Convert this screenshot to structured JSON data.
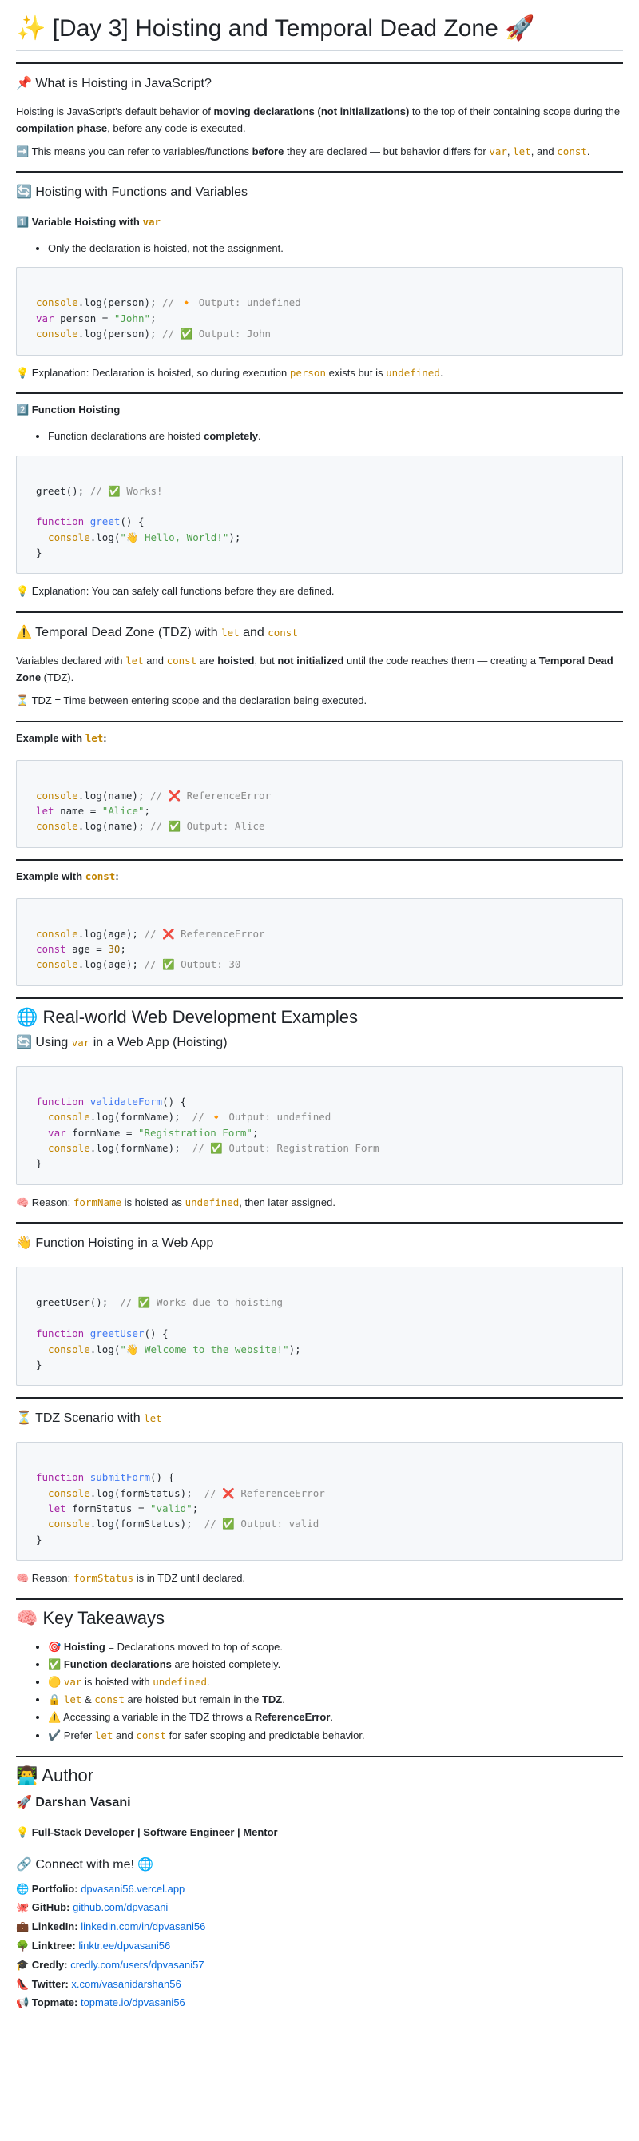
{
  "title": "✨ [Day 3] Hoisting and Temporal Dead Zone 🚀",
  "s1": {
    "heading": "📌 What is Hoisting in JavaScript?",
    "p1_a": "Hoisting is JavaScript's default behavior of ",
    "p1_b": "moving declarations (not initializations)",
    "p1_c": " to the top of their containing scope during the ",
    "p1_d": "compilation phase",
    "p1_e": ", before any code is executed.",
    "p2_a": "➡️ This means you can refer to variables/functions ",
    "p2_b": "before",
    "p2_c": " they are declared — but behavior differs for ",
    "var": "var",
    "let": "let",
    "const": "const",
    "and": ", and ",
    "comma": ", ",
    "dot": "."
  },
  "s2": {
    "heading": "🔄 Hoisting with Functions and Variables",
    "sub1_a": "1️⃣ Variable Hoisting with ",
    "sub1_code": "var",
    "sub1_bullet": "Only the declaration is hoisted, not the assignment.",
    "code1": {
      "l1a": "console",
      "l1b": ".log(person); ",
      "l1c": "// 🔸 Output: undefined",
      "l2a": "var",
      "l2b": " person = ",
      "l2c": "\"John\"",
      "l2d": ";",
      "l3a": "console",
      "l3b": ".log(person); ",
      "l3c": "// ✅ Output: John"
    },
    "expl1_a": "💡 Explanation: Declaration is hoisted, so during execution ",
    "expl1_b": "person",
    "expl1_c": " exists but is ",
    "expl1_d": "undefined",
    "expl1_e": ".",
    "sub2": "2️⃣ Function Hoisting",
    "sub2_bullet_a": "Function declarations are hoisted ",
    "sub2_bullet_b": "completely",
    "sub2_bullet_c": ".",
    "code2": {
      "l1a": "greet(); ",
      "l1b": "// ✅ Works!",
      "l3a": "function",
      "l3b": " greet",
      "l3c": "() {",
      "l4a": "  console",
      "l4b": ".log(",
      "l4c": "\"👋 Hello, World!\"",
      "l4d": ");",
      "l5": "}"
    },
    "expl2": "💡 Explanation: You can safely call functions before they are defined."
  },
  "s3": {
    "heading_a": "⚠️ Temporal Dead Zone (TDZ) with ",
    "heading_b": "let",
    "heading_c": " and ",
    "heading_d": "const",
    "p1_a": "Variables declared with ",
    "p1_b": "let",
    "p1_c": " and ",
    "p1_d": "const",
    "p1_e": " are ",
    "p1_f": "hoisted",
    "p1_g": ", but ",
    "p1_h": "not initialized",
    "p1_i": " until the code reaches them — creating a ",
    "p1_j": "Temporal Dead Zone",
    "p1_k": " (TDZ).",
    "p2": "⏳ TDZ = Time between entering scope and the declaration being executed.",
    "ex1_a": "Example with ",
    "ex1_b": "let",
    "ex1_c": ":",
    "code1": {
      "l1a": "console",
      "l1b": ".log(name); ",
      "l1c": "// ❌ ReferenceError",
      "l2a": "let",
      "l2b": " name = ",
      "l2c": "\"Alice\"",
      "l2d": ";",
      "l3a": "console",
      "l3b": ".log(name); ",
      "l3c": "// ✅ Output: Alice"
    },
    "ex2_a": "Example with ",
    "ex2_b": "const",
    "ex2_c": ":",
    "code2": {
      "l1a": "console",
      "l1b": ".log(age); ",
      "l1c": "// ❌ ReferenceError",
      "l2a": "const",
      "l2b": " age = ",
      "l2c": "30",
      "l2d": ";",
      "l3a": "console",
      "l3b": ".log(age); ",
      "l3c": "// ✅ Output: 30"
    }
  },
  "s4": {
    "heading": "🌐 Real-world Web Development Examples",
    "sub1_a": "🔄 Using ",
    "sub1_b": "var",
    "sub1_c": " in a Web App (Hoisting)",
    "code1": {
      "l1a": "function",
      "l1b": " validateForm",
      "l1c": "() {",
      "l2a": "  console",
      "l2b": ".log(formName);  ",
      "l2c": "// 🔸 Output: undefined",
      "l3a": "  var",
      "l3b": " formName = ",
      "l3c": "\"Registration Form\"",
      "l3d": ";",
      "l4a": "  console",
      "l4b": ".log(formName);  ",
      "l4c": "// ✅ Output: Registration Form",
      "l5": "}"
    },
    "reason1_a": "🧠 Reason: ",
    "reason1_b": "formName",
    "reason1_c": " is hoisted as ",
    "reason1_d": "undefined",
    "reason1_e": ", then later assigned.",
    "sub2": "👋 Function Hoisting in a Web App",
    "code2": {
      "l1a": "greetUser();  ",
      "l1b": "// ✅ Works due to hoisting",
      "l3a": "function",
      "l3b": " greetUser",
      "l3c": "() {",
      "l4a": "  console",
      "l4b": ".log(",
      "l4c": "\"👋 Welcome to the website!\"",
      "l4d": ");",
      "l5": "}"
    },
    "sub3_a": "⏳ TDZ Scenario with ",
    "sub3_b": "let",
    "code3": {
      "l1a": "function",
      "l1b": " submitForm",
      "l1c": "() {",
      "l2a": "  console",
      "l2b": ".log(formStatus);  ",
      "l2c": "// ❌ ReferenceError",
      "l3a": "  let",
      "l3b": " formStatus = ",
      "l3c": "\"valid\"",
      "l3d": ";",
      "l4a": "  console",
      "l4b": ".log(formStatus);  ",
      "l4c": "// ✅ Output: valid",
      "l5": "}"
    },
    "reason2_a": "🧠 Reason: ",
    "reason2_b": "formStatus",
    "reason2_c": " is in TDZ until declared."
  },
  "s5": {
    "heading": "🧠 Key Takeaways",
    "t1_a": "🎯 ",
    "t1_b": "Hoisting",
    "t1_c": " = Declarations moved to top of scope.",
    "t2_a": "✅ ",
    "t2_b": "Function declarations",
    "t2_c": " are hoisted completely.",
    "t3_a": "🟡 ",
    "t3_b": "var",
    "t3_c": " is hoisted with ",
    "t3_d": "undefined",
    "t3_e": ".",
    "t4_a": "🔒 ",
    "t4_b": "let",
    "t4_c": " & ",
    "t4_d": "const",
    "t4_e": " are hoisted but remain in the ",
    "t4_f": "TDZ",
    "t4_g": ".",
    "t5_a": "⚠️ Accessing a variable in the TDZ throws a ",
    "t5_b": "ReferenceError",
    "t5_c": ".",
    "t6_a": "✔️ Prefer ",
    "t6_b": "let",
    "t6_c": " and ",
    "t6_d": "const",
    "t6_e": " for safer scoping and predictable behavior."
  },
  "s6": {
    "heading": "👨‍💻 Author",
    "name": "🚀 Darshan Vasani",
    "role": "💡 Full-Stack Developer | Software Engineer | Mentor",
    "connect": "🔗 Connect with me! 🌐",
    "links": [
      {
        "label": "🌐 Portfolio:",
        "url": "dpvasani56.vercel.app"
      },
      {
        "label": "🐙 GitHub:",
        "url": "github.com/dpvasani"
      },
      {
        "label": "💼 LinkedIn:",
        "url": "linkedin.com/in/dpvasani56"
      },
      {
        "label": "🌳 Linktree:",
        "url": "linktr.ee/dpvasani56"
      },
      {
        "label": "🎓 Credly:",
        "url": "credly.com/users/dpvasani57"
      },
      {
        "label": "👠 Twitter:",
        "url": "x.com/vasanidarshan56"
      },
      {
        "label": "📢 Topmate:",
        "url": "topmate.io/dpvasani56"
      }
    ]
  }
}
